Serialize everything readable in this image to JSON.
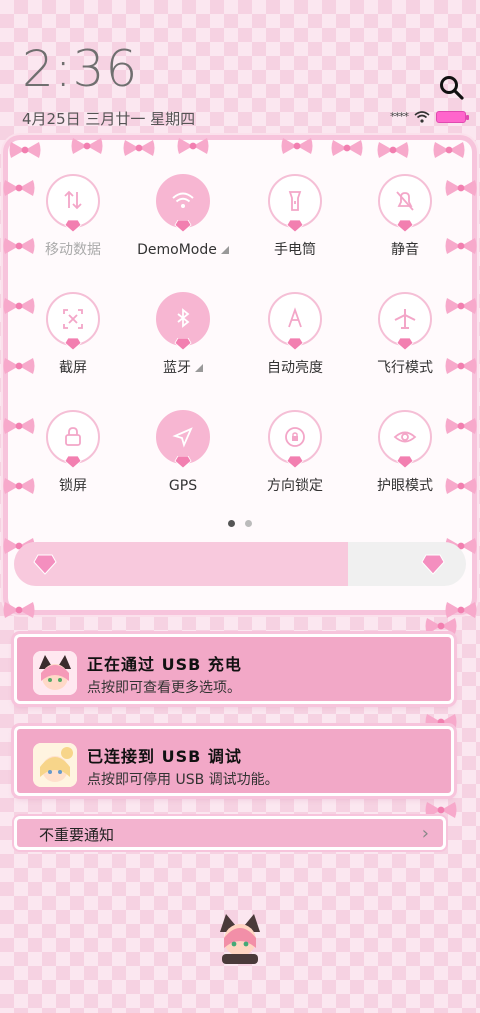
{
  "status": {
    "time": "2:36",
    "date": "4月25日 三月廿一 星期四",
    "carrier": "****"
  },
  "quick_settings": {
    "tiles": [
      {
        "label": "移动数据",
        "icon": "swap-arrows-icon",
        "on": false,
        "dim": true,
        "caret": false
      },
      {
        "label": "DemoMode",
        "icon": "wifi-icon",
        "on": true,
        "dim": false,
        "caret": true
      },
      {
        "label": "手电筒",
        "icon": "flashlight-icon",
        "on": false,
        "dim": false,
        "caret": false
      },
      {
        "label": "静音",
        "icon": "bell-off-icon",
        "on": false,
        "dim": false,
        "caret": false
      },
      {
        "label": "截屏",
        "icon": "screenshot-icon",
        "on": false,
        "dim": false,
        "caret": false
      },
      {
        "label": "蓝牙",
        "icon": "bluetooth-icon",
        "on": true,
        "dim": false,
        "caret": true
      },
      {
        "label": "自动亮度",
        "icon": "auto-brightness-icon",
        "on": false,
        "dim": false,
        "caret": false
      },
      {
        "label": "飞行模式",
        "icon": "airplane-icon",
        "on": false,
        "dim": false,
        "caret": false
      },
      {
        "label": "锁屏",
        "icon": "lock-icon",
        "on": false,
        "dim": false,
        "caret": false
      },
      {
        "label": "GPS",
        "icon": "location-arrow-icon",
        "on": true,
        "dim": false,
        "caret": false
      },
      {
        "label": "方向锁定",
        "icon": "rotation-lock-icon",
        "on": false,
        "dim": false,
        "caret": false
      },
      {
        "label": "护眼模式",
        "icon": "eye-icon",
        "on": false,
        "dim": false,
        "caret": false
      }
    ],
    "page_count": 2,
    "active_page": 1
  },
  "brightness": {
    "level": 0.74
  },
  "notifications": [
    {
      "title": "正在通过  USB  充电",
      "subtitle": "点按即可查看更多选项。"
    },
    {
      "title": "已连接到  USB  调试",
      "subtitle": "点按即可停用 USB 调试功能。"
    }
  ],
  "minor_notifications": {
    "label": "不重要通知"
  },
  "colors": {
    "accent": "#f2a8c7",
    "tile_on": "#f7b6d2",
    "battery": "#ff66cc"
  }
}
